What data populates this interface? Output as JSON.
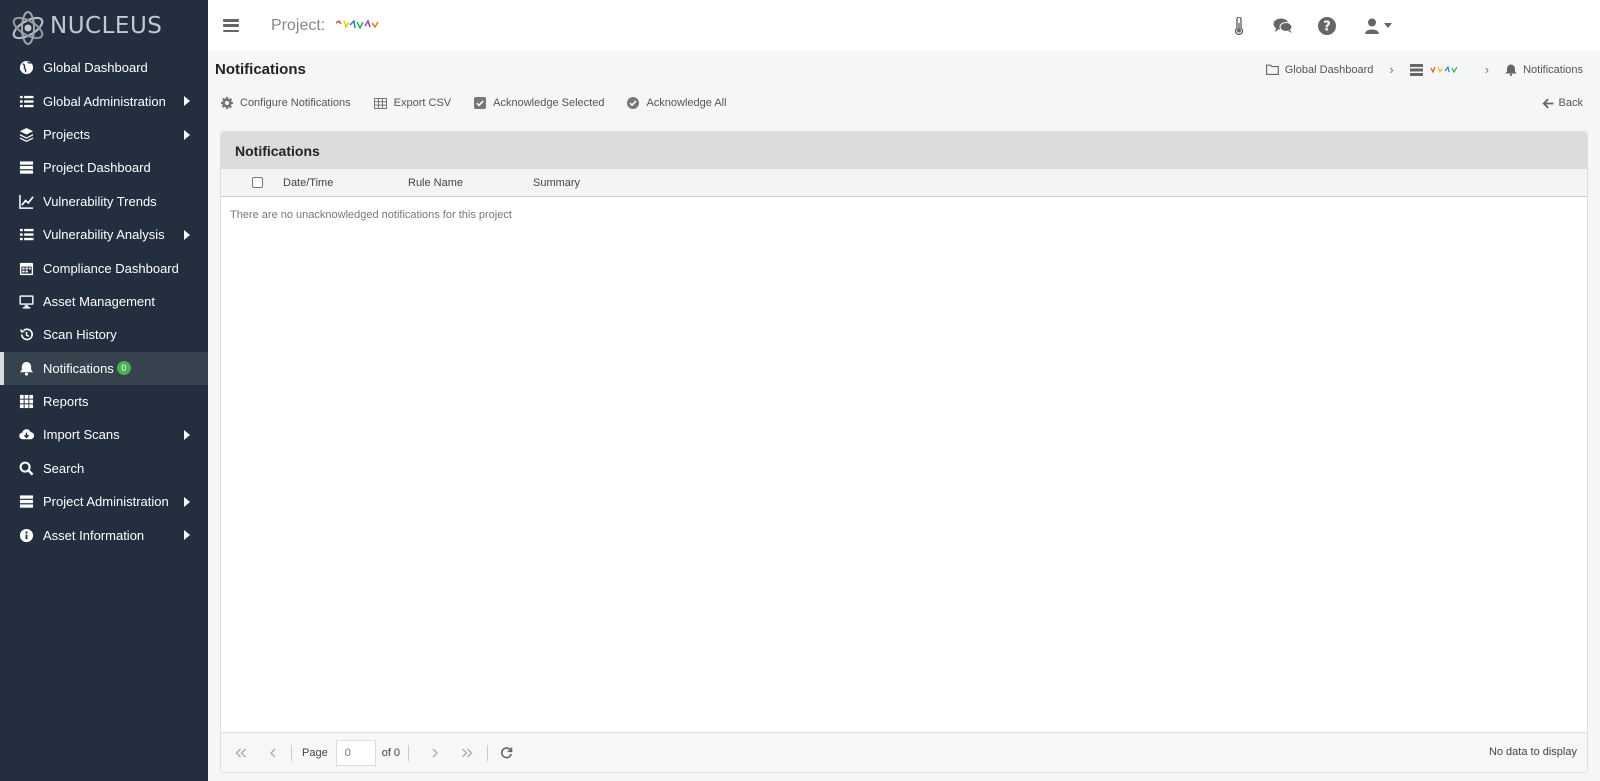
{
  "app": {
    "logo_text": "NUCLEUS"
  },
  "topbar": {
    "project_label": "Project:"
  },
  "sidebar": {
    "items": [
      {
        "label": "Global Dashboard",
        "icon": "globe-icon",
        "arrow": false
      },
      {
        "label": "Global Administration",
        "icon": "list-icon",
        "arrow": true
      },
      {
        "label": "Projects",
        "icon": "layers-icon",
        "arrow": true
      },
      {
        "label": "Project Dashboard",
        "icon": "server-icon",
        "arrow": false
      },
      {
        "label": "Vulnerability Trends",
        "icon": "line-chart-icon",
        "arrow": false
      },
      {
        "label": "Vulnerability Analysis",
        "icon": "list-icon",
        "arrow": true
      },
      {
        "label": "Compliance Dashboard",
        "icon": "calendar-icon",
        "arrow": false
      },
      {
        "label": "Asset Management",
        "icon": "desktop-icon",
        "arrow": false
      },
      {
        "label": "Scan History",
        "icon": "history-icon",
        "arrow": false
      },
      {
        "label": "Notifications",
        "icon": "bell-icon",
        "arrow": false,
        "badge": "0",
        "active": true
      },
      {
        "label": "Reports",
        "icon": "grid-icon",
        "arrow": false
      },
      {
        "label": "Import Scans",
        "icon": "cloud-download-icon",
        "arrow": true
      },
      {
        "label": "Search",
        "icon": "search-icon",
        "arrow": false
      },
      {
        "label": "Project Administration",
        "icon": "server-icon",
        "arrow": true
      },
      {
        "label": "Asset Information",
        "icon": "info-icon",
        "arrow": true
      }
    ]
  },
  "header": {
    "title": "Notifications",
    "breadcrumb": {
      "home": "Global Dashboard",
      "current": "Notifications"
    }
  },
  "toolbar": {
    "configure": "Configure Notifications",
    "export": "Export CSV",
    "ack_selected": "Acknowledge Selected",
    "ack_all": "Acknowledge All",
    "back": "Back"
  },
  "panel": {
    "title": "Notifications",
    "columns": [
      "Date/Time",
      "Rule Name",
      "Summary"
    ],
    "empty_message": "There are no unacknowledged notifications for this project"
  },
  "pager": {
    "page_label": "Page",
    "page_value": "0",
    "of_label": "of 0",
    "status": "No data to display"
  },
  "colors": {
    "sidebar_bg": "#232f3e",
    "badge": "#4caf50",
    "panel_head": "#dcdcdc"
  }
}
